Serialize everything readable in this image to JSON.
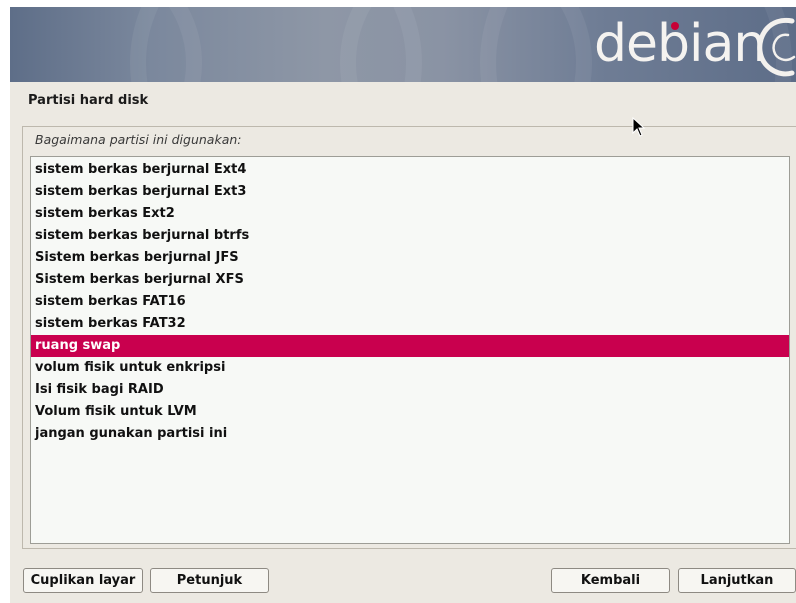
{
  "banner": {
    "logo_text": "debian",
    "accent_color": "#c70036"
  },
  "page": {
    "title": "Partisi hard disk"
  },
  "question": {
    "label": "Bagaimana partisi ini digunakan:"
  },
  "options": [
    {
      "label": "sistem berkas berjurnal Ext4",
      "selected": false
    },
    {
      "label": "sistem berkas berjurnal Ext3",
      "selected": false
    },
    {
      "label": "sistem berkas Ext2",
      "selected": false
    },
    {
      "label": "sistem berkas berjurnal btrfs",
      "selected": false
    },
    {
      "label": "Sistem berkas berjurnal JFS",
      "selected": false
    },
    {
      "label": "Sistem berkas berjurnal XFS",
      "selected": false
    },
    {
      "label": "sistem berkas FAT16",
      "selected": false
    },
    {
      "label": "sistem berkas FAT32",
      "selected": false
    },
    {
      "label": "ruang swap",
      "selected": true
    },
    {
      "label": "volum fisik untuk enkripsi",
      "selected": false
    },
    {
      "label": "Isi fisik bagi RAID",
      "selected": false
    },
    {
      "label": "Volum fisik untuk LVM",
      "selected": false
    },
    {
      "label": "jangan gunakan partisi ini",
      "selected": false
    }
  ],
  "buttons": {
    "screenshot": "Cuplikan layar",
    "help": "Petunjuk",
    "back": "Kembali",
    "continue": "Lanjutkan"
  },
  "colors": {
    "selection": "#c9004e",
    "background": "#ece9e2"
  }
}
